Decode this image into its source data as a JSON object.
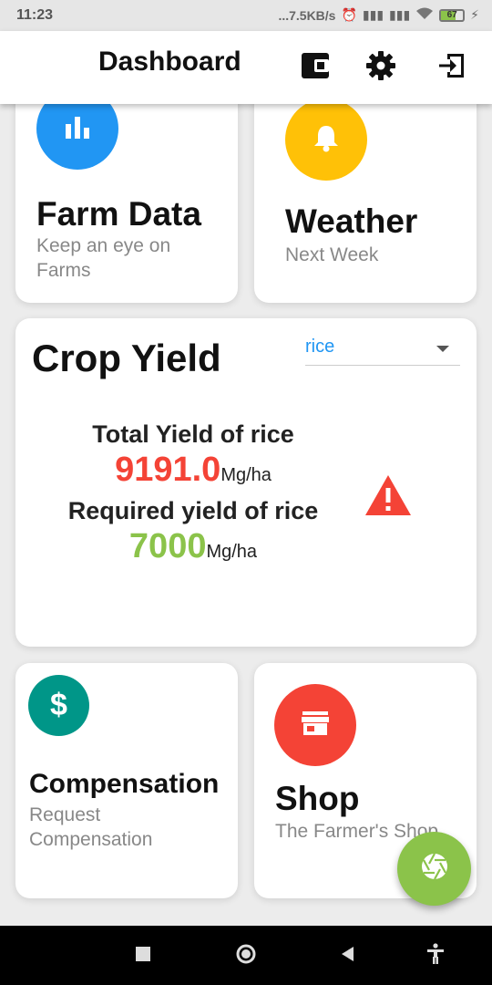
{
  "status_bar": {
    "time": "11:23",
    "net_speed": "...7.5KB/s",
    "battery": "67"
  },
  "app_bar": {
    "title": "Dashboard",
    "actions": [
      "wallet-icon",
      "settings-gear-icon",
      "logout-icon"
    ]
  },
  "cards": {
    "farm_data": {
      "title": "Farm Data",
      "subtitle": "Keep an eye on Farms",
      "icon": "bar-chart-icon",
      "color": "#2196f3"
    },
    "weather": {
      "title": "Weather",
      "subtitle": "Next Week",
      "icon": "bell-icon",
      "color": "#ffc107"
    },
    "compensation": {
      "title": "Compensation",
      "subtitle": "Request Compensation",
      "icon": "dollar-icon",
      "color": "#009688"
    },
    "shop": {
      "title": "Shop",
      "subtitle": "The Farmer's Shop",
      "icon": "store-icon",
      "color": "#f44336"
    }
  },
  "crop_yield": {
    "title": "Crop Yield",
    "selected_crop": "rice",
    "total_label": "Total Yield of rice",
    "total_value": "9191.0",
    "total_unit": "Mg/ha",
    "required_label": "Required yield of rice",
    "required_value": "7000",
    "required_unit": "Mg/ha",
    "warning_icon": "warning-triangle-icon",
    "colors": {
      "total": "#f44336",
      "required": "#8bc34a",
      "warning": "#f44336"
    }
  },
  "fab": {
    "icon": "camera-shutter-icon",
    "color": "#8bc34a"
  },
  "nav_bar": [
    "recent-apps-icon",
    "home-icon",
    "back-icon",
    "accessibility-icon"
  ]
}
